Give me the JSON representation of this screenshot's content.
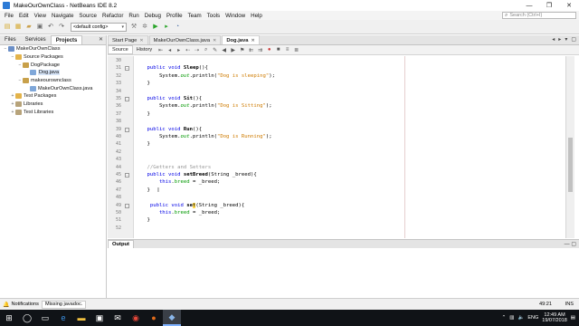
{
  "window": {
    "title": "MakeOurOwnClass - NetBeans IDE 8.2"
  },
  "menu": [
    "File",
    "Edit",
    "View",
    "Navigate",
    "Source",
    "Refactor",
    "Run",
    "Debug",
    "Profile",
    "Team",
    "Tools",
    "Window",
    "Help"
  ],
  "search": {
    "placeholder": "Search (Ctrl+I)"
  },
  "toolbar": {
    "config": "<default config>"
  },
  "left_panel": {
    "tabs": [
      "Files",
      "Services",
      "Projects"
    ],
    "active_tab": "Projects",
    "tree": [
      {
        "label": "MakeOurOwnClass",
        "depth": 0,
        "icon": "project-icon",
        "toggle": "−"
      },
      {
        "label": "Source Packages",
        "depth": 1,
        "icon": "package-folder-icon",
        "toggle": "−"
      },
      {
        "label": "DogPackage",
        "depth": 2,
        "icon": "package-icon",
        "toggle": "−"
      },
      {
        "label": "Dog.java",
        "depth": 3,
        "icon": "java-file-icon",
        "toggle": "",
        "selected": true
      },
      {
        "label": "makeourownclass",
        "depth": 2,
        "icon": "package-icon",
        "toggle": "−"
      },
      {
        "label": "MakeOurOwnClass.java",
        "depth": 3,
        "icon": "java-file-icon",
        "toggle": ""
      },
      {
        "label": "Test Packages",
        "depth": 1,
        "icon": "package-folder-icon",
        "toggle": "+"
      },
      {
        "label": "Libraries",
        "depth": 1,
        "icon": "library-icon",
        "toggle": "+"
      },
      {
        "label": "Test Libraries",
        "depth": 1,
        "icon": "library-icon",
        "toggle": "+"
      }
    ]
  },
  "editor": {
    "tabs": [
      {
        "label": "Start Page",
        "active": false
      },
      {
        "label": "MakeOurOwnClass.java",
        "active": false
      },
      {
        "label": "Dog.java",
        "active": true
      }
    ],
    "view_tabs": [
      "Source",
      "History"
    ],
    "active_view": "Source",
    "lines": [
      {
        "n": "30",
        "fold": false,
        "segs": []
      },
      {
        "n": "31",
        "fold": true,
        "segs": [
          {
            "c": "kw",
            "t": "    public void "
          },
          {
            "c": "fn",
            "t": "Sleep"
          },
          {
            "c": "",
            "t": "(){"
          }
        ]
      },
      {
        "n": "32",
        "fold": false,
        "segs": [
          {
            "c": "",
            "t": "        System."
          },
          {
            "c": "out",
            "t": "out"
          },
          {
            "c": "",
            "t": ".println("
          },
          {
            "c": "st",
            "t": "\"Dog is sleeping\""
          },
          {
            "c": "",
            "t": ");"
          }
        ]
      },
      {
        "n": "33",
        "fold": false,
        "segs": [
          {
            "c": "",
            "t": "    }"
          }
        ]
      },
      {
        "n": "34",
        "fold": false,
        "segs": []
      },
      {
        "n": "35",
        "fold": true,
        "segs": [
          {
            "c": "kw",
            "t": "    public void "
          },
          {
            "c": "fn",
            "t": "Sit"
          },
          {
            "c": "",
            "t": "(){"
          }
        ]
      },
      {
        "n": "36",
        "fold": false,
        "segs": [
          {
            "c": "",
            "t": "        System."
          },
          {
            "c": "out",
            "t": "out"
          },
          {
            "c": "",
            "t": ".println("
          },
          {
            "c": "st",
            "t": "\"Dog is Sitting\""
          },
          {
            "c": "",
            "t": ");"
          }
        ]
      },
      {
        "n": "37",
        "fold": false,
        "segs": [
          {
            "c": "",
            "t": "    }"
          }
        ]
      },
      {
        "n": "38",
        "fold": false,
        "segs": []
      },
      {
        "n": "39",
        "fold": true,
        "segs": [
          {
            "c": "kw",
            "t": "    public void "
          },
          {
            "c": "fn",
            "t": "Run"
          },
          {
            "c": "",
            "t": "(){"
          }
        ]
      },
      {
        "n": "40",
        "fold": false,
        "segs": [
          {
            "c": "",
            "t": "        System."
          },
          {
            "c": "out",
            "t": "out"
          },
          {
            "c": "",
            "t": ".println("
          },
          {
            "c": "st",
            "t": "\"Dog is Running\""
          },
          {
            "c": "",
            "t": ");"
          }
        ]
      },
      {
        "n": "41",
        "fold": false,
        "segs": [
          {
            "c": "",
            "t": "    }"
          }
        ]
      },
      {
        "n": "42",
        "fold": false,
        "segs": []
      },
      {
        "n": "43",
        "fold": false,
        "segs": []
      },
      {
        "n": "44",
        "fold": false,
        "segs": [
          {
            "c": "cm",
            "t": "    //Getters and Setters"
          }
        ]
      },
      {
        "n": "45",
        "fold": true,
        "segs": [
          {
            "c": "kw",
            "t": "    public void "
          },
          {
            "c": "fn",
            "t": "setBreed"
          },
          {
            "c": "",
            "t": "(String _breed){"
          }
        ]
      },
      {
        "n": "46",
        "fold": false,
        "segs": [
          {
            "c": "kw",
            "t": "        this"
          },
          {
            "c": "",
            "t": "."
          },
          {
            "c": "fld",
            "t": "breed"
          },
          {
            "c": "",
            "t": " = _breed;"
          }
        ]
      },
      {
        "n": "47",
        "fold": false,
        "segs": [
          {
            "c": "",
            "t": "    }"
          }
        ]
      },
      {
        "n": "48",
        "fold": false,
        "segs": []
      },
      {
        "n": "49",
        "fold": true,
        "segs": [
          {
            "c": "kw",
            "t": "     public void "
          },
          {
            "c": "fn",
            "t": "se"
          },
          {
            "c": "caret-sel",
            "t": "t"
          },
          {
            "c": "",
            "t": "(String _breed){"
          }
        ]
      },
      {
        "n": "50",
        "fold": false,
        "segs": [
          {
            "c": "kw",
            "t": "        this"
          },
          {
            "c": "",
            "t": "."
          },
          {
            "c": "fld",
            "t": "breed"
          },
          {
            "c": "",
            "t": " = _breed;"
          }
        ]
      },
      {
        "n": "51",
        "fold": false,
        "segs": [
          {
            "c": "",
            "t": "    }"
          }
        ]
      },
      {
        "n": "52",
        "fold": false,
        "segs": []
      }
    ]
  },
  "output": {
    "title": "Output"
  },
  "status": {
    "notifications": "Notifications",
    "message": "Missing javadoc.",
    "position": "49:21",
    "mode": "INS"
  },
  "taskbar": {
    "lang": "ENG",
    "time": "12:49 AM",
    "date": "19/07/2018"
  }
}
